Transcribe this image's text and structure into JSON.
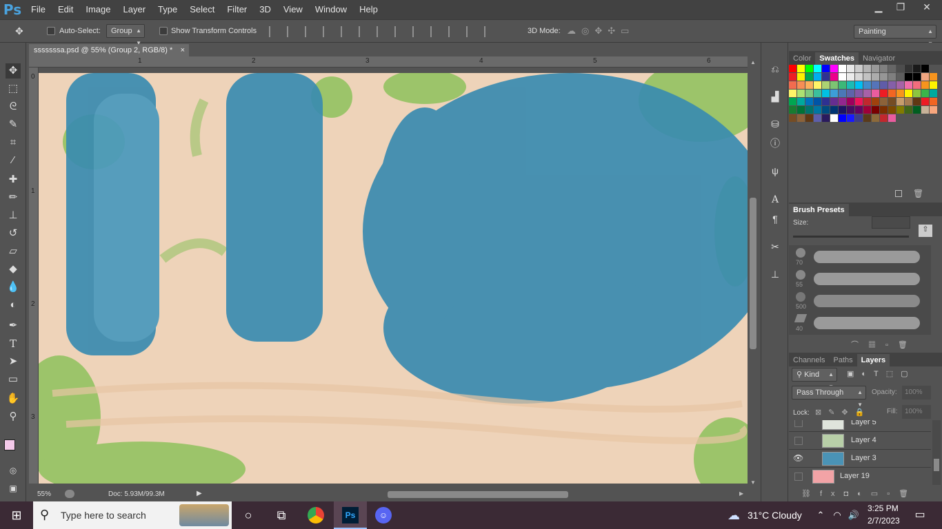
{
  "menubar": {
    "logo": "Ps",
    "items": [
      "File",
      "Edit",
      "Image",
      "Layer",
      "Type",
      "Select",
      "Filter",
      "3D",
      "View",
      "Window",
      "Help"
    ],
    "controls": {
      "minimize": "▁",
      "restore": "❐",
      "close": "✕"
    }
  },
  "options": {
    "auto_select_label": "Auto-Select:",
    "auto_select_value": "Group",
    "show_transform_label": "Show Transform Controls",
    "mode_3d_label": "3D Mode:",
    "workspace_value": "Painting"
  },
  "document_tab": {
    "title": "sssssssa.psd @ 55% (Group 2, RGB/8) *",
    "close": "×"
  },
  "rulers": {
    "h_labels": [
      "1",
      "2",
      "3",
      "4",
      "5",
      "6"
    ],
    "v_labels": [
      "0",
      "1",
      "2",
      "3"
    ]
  },
  "status": {
    "zoom": "55%",
    "doc": "Doc: 5.93M/99.3M"
  },
  "swatches_panel": {
    "tabs": [
      "Color",
      "Swatches",
      "Navigator"
    ],
    "active_tab": "Swatches"
  },
  "brush_presets": {
    "title": "Brush Presets",
    "size_label": "Size:",
    "brush_sizes": [
      "70",
      "55",
      "500",
      "40"
    ]
  },
  "layers_panel": {
    "tabs": [
      "Channels",
      "Paths",
      "Layers"
    ],
    "kind_label": "Kind",
    "blend_mode": "Pass Through",
    "opacity_label": "Opacity:",
    "opacity_value": "100%",
    "lock_label": "Lock:",
    "fill_label": "Fill:",
    "fill_value": "100%",
    "layers": [
      {
        "name": "Layer 5",
        "visible": false
      },
      {
        "name": "Layer 4",
        "visible": false
      },
      {
        "name": "Layer 3",
        "visible": true
      },
      {
        "name": "Layer 19",
        "visible": false
      }
    ]
  },
  "taskbar": {
    "search_placeholder": "Type here to search",
    "weather": "31°C  Cloudy",
    "time": "3:25 PM",
    "date": "2/7/2023"
  },
  "colors": {
    "canvas_skin": "#eed3b9",
    "canvas_blue": "#3a8bb0",
    "canvas_green": "#9cc46a",
    "foreground": "#f3c9e9",
    "background": "#4b87d6"
  }
}
